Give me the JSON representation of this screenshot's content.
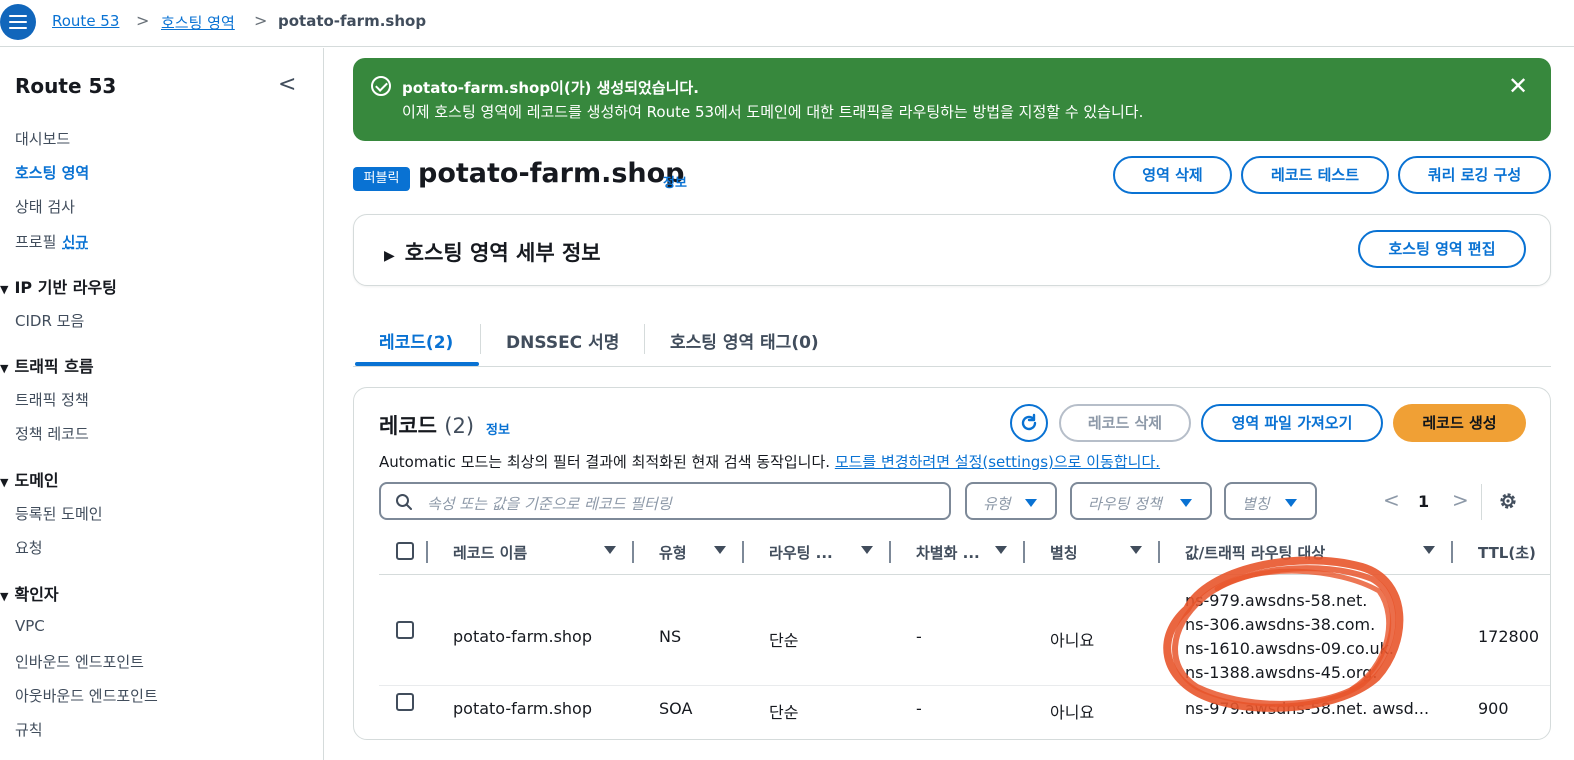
{
  "breadcrumb": {
    "items": [
      "Route 53",
      "호스팅 영역",
      "potato-farm.shop"
    ],
    "separator": ">"
  },
  "sidebar": {
    "title": "Route 53",
    "collapse_icon": "<",
    "items": {
      "dashboard": "대시보드",
      "hosted_zones": "호스팅 영역",
      "health_checks": "상태 검사",
      "profiles": "프로필",
      "profiles_badge": "신규",
      "cidr": "CIDR 모음",
      "traffic_policy": "트래픽 정책",
      "policy_records": "정책 레코드",
      "registered_domains": "등록된 도메인",
      "requests": "요청",
      "vpc": "VPC",
      "inbound": "인바운드 엔드포인트",
      "outbound": "아웃바운드 엔드포인트",
      "rules": "규칙"
    },
    "groups": {
      "ip_routing": "IP 기반 라우팅",
      "traffic_flow": "트래픽 흐름",
      "domains": "도메인",
      "resolver": "확인자"
    },
    "group_icon": "▼"
  },
  "flash": {
    "title": "potato-farm.shop이(가) 생성되었습니다.",
    "message": "이제 호스팅 영역에 레코드를 생성하여 Route 53에서 도메인에 대한 트래픽을 라우팅하는 방법을 지정할 수 있습니다.",
    "close": "✕",
    "color": "#37883d"
  },
  "header": {
    "badge": "퍼블릭",
    "title": "potato-farm.shop",
    "info": "정보",
    "buttons": {
      "delete_zone": "영역 삭제",
      "test_record": "레코드 테스트",
      "query_logging": "쿼리 로깅 구성"
    }
  },
  "details": {
    "toggle": "▶",
    "title": "호스팅 영역 세부 정보",
    "edit_button": "호스팅 영역 편집"
  },
  "tabs": [
    {
      "label": "레코드(2)",
      "active": true
    },
    {
      "label": "DNSSEC 서명",
      "active": false
    },
    {
      "label": "호스팅 영역 태그(0)",
      "active": false
    }
  ],
  "records": {
    "title": "레코드",
    "count": "(2)",
    "info": "정보",
    "delete_button": "레코드 삭제",
    "import_button": "영역 파일 가져오기",
    "create_button": "레코드 생성",
    "description": "Automatic 모드는 최상의 필터 결과에 최적화된 현재 검색 동작입니다.",
    "description_link": "모드를 변경하려면 설정(settings)으로 이동합니다.",
    "search_placeholder": "속성 또는 값을 기준으로 레코드 필터링",
    "filters": [
      "유형",
      "라우팅 정책",
      "별칭"
    ],
    "pagination": {
      "prev": "<",
      "page": "1",
      "next": ">"
    },
    "columns": [
      "레코드 이름",
      "유형",
      "라우팅 ...",
      "차별화 ...",
      "별칭",
      "값/트래픽 라우팅 대상",
      "TTL(초)"
    ],
    "rows": [
      {
        "name": "potato-farm.shop",
        "type": "NS",
        "routing": "단순",
        "differentiator": "-",
        "alias": "아니요",
        "values": [
          "ns-979.awsdns-58.net.",
          "ns-306.awsdns-38.com.",
          "ns-1610.awsdns-09.co.uk.",
          "ns-1388.awsdns-45.org."
        ],
        "ttl": "172800"
      },
      {
        "name": "potato-farm.shop",
        "type": "SOA",
        "routing": "단순",
        "differentiator": "-",
        "alias": "아니요",
        "value": "ns-979.awsdns-58.net. awsd...",
        "ttl": "900"
      }
    ],
    "annotation_color": "#e8552b",
    "primary_color": "#f0a035",
    "accent_color": "#0972d3"
  }
}
